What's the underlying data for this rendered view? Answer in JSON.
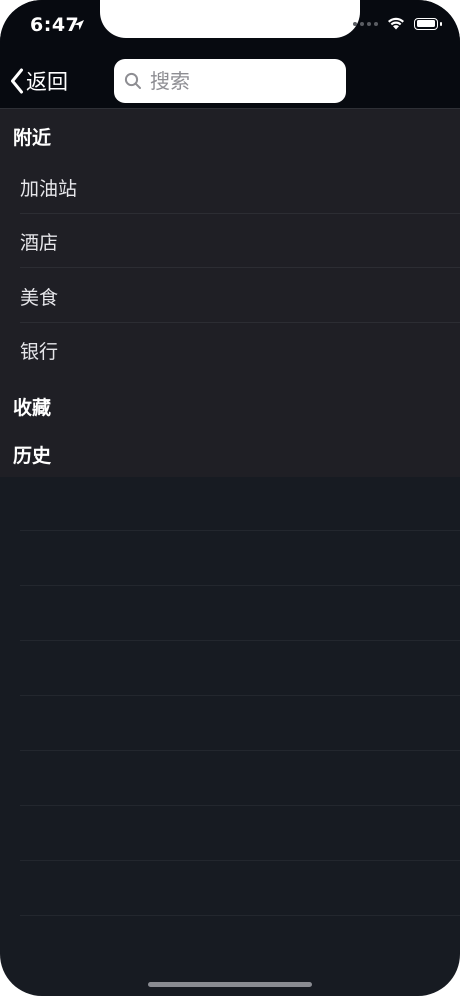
{
  "status_bar": {
    "time": "6:47"
  },
  "nav": {
    "back_label": "返回",
    "search_placeholder": "搜索",
    "search_value": ""
  },
  "sections": {
    "nearby_title": "附近",
    "nearby_items": [
      "加油站",
      "酒店",
      "美食",
      "银行"
    ],
    "favorites_title": "收藏",
    "history_title": "历史"
  },
  "colors": {
    "background": "#171b22",
    "menu_background": "#1f1f25",
    "top_bar": "#070a10",
    "text": "#ffffff"
  }
}
